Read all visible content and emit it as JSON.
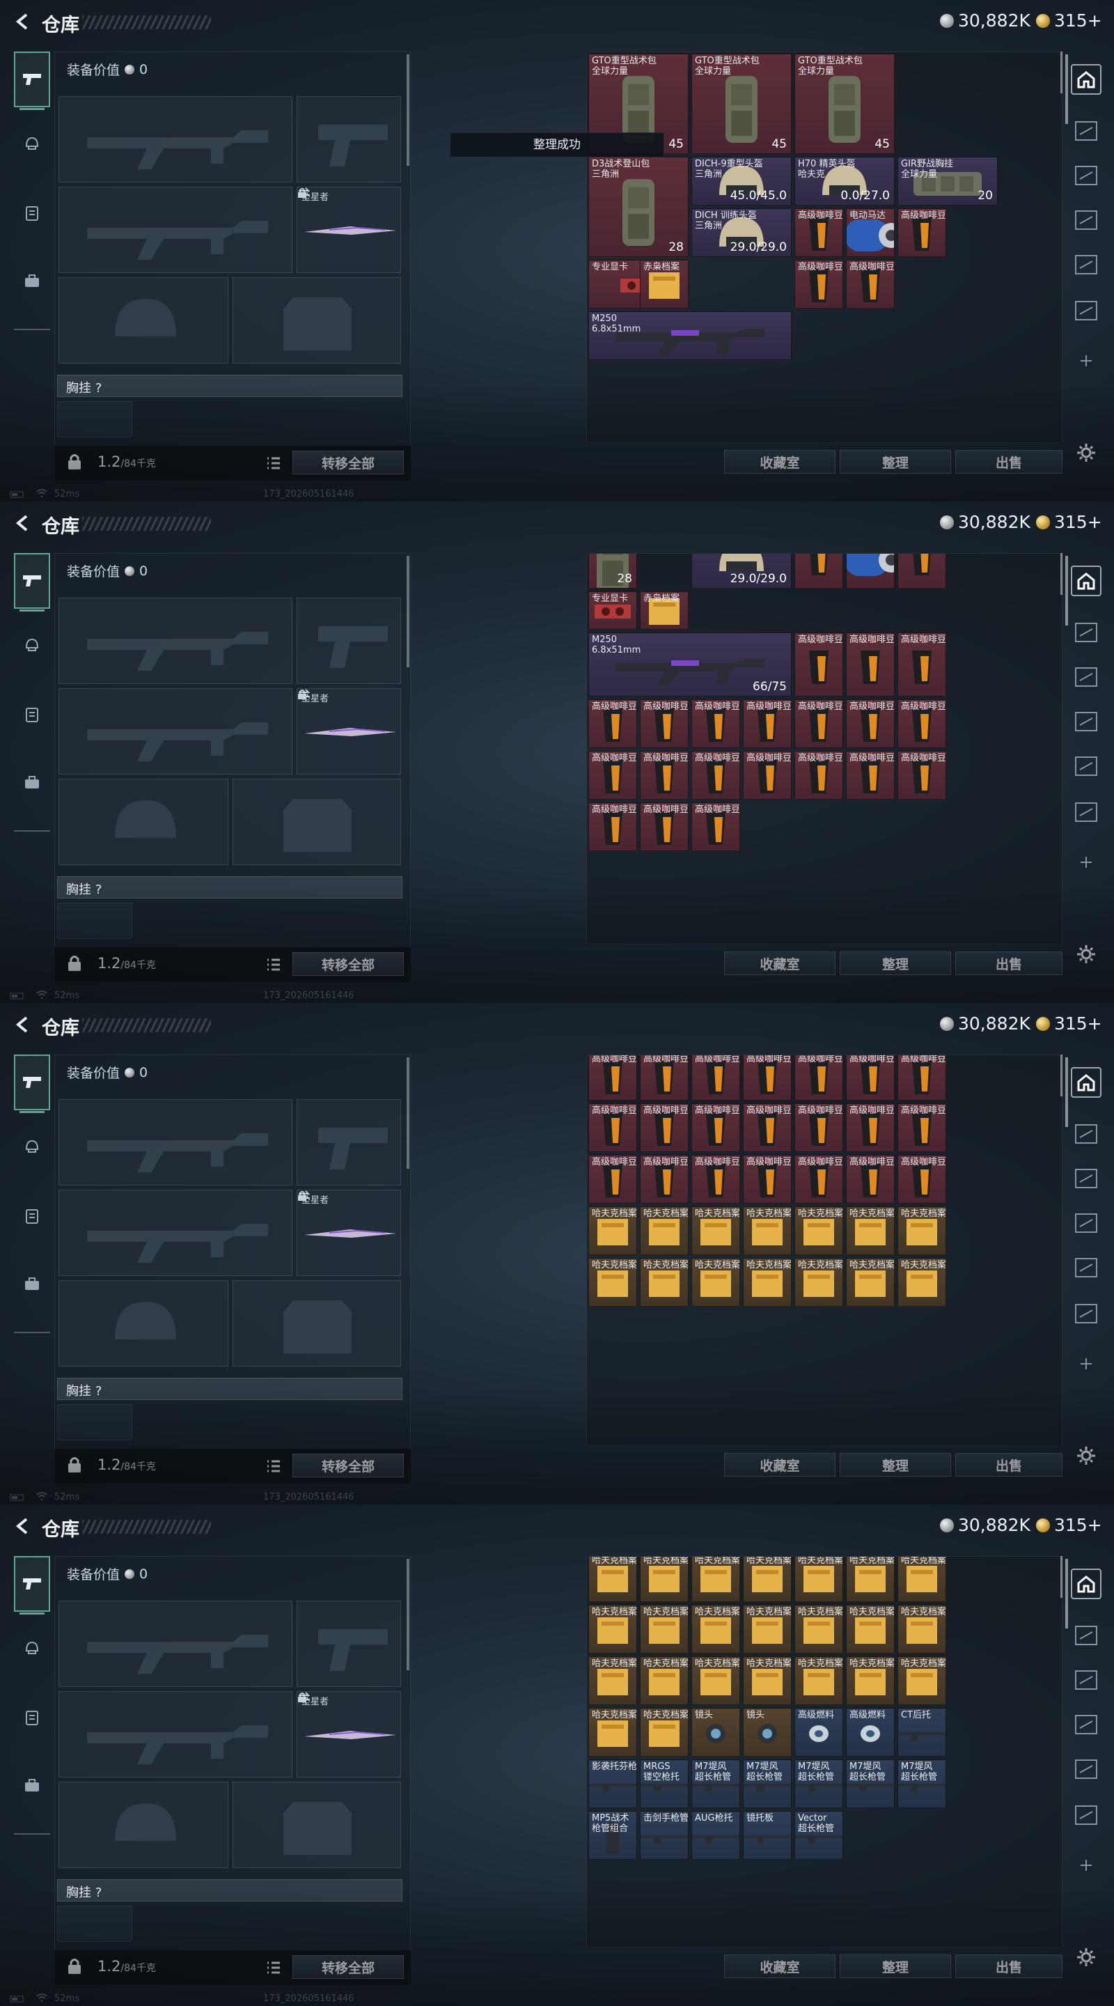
{
  "header": {
    "title": "仓库",
    "currency_silver": "30,882K",
    "currency_gold": "315+"
  },
  "loadout": {
    "equip_value_label": "装备价值",
    "equip_value": "0",
    "knife_label": "坠星者",
    "vest_label": "胸挂 ?",
    "weight_value": "1.2",
    "weight_capacity": "/84千克",
    "transfer_all": "转移全部"
  },
  "stash_buttons": {
    "collection": "收藏室",
    "sort": "整理",
    "sell": "出售"
  },
  "toast": "整理成功",
  "footer": {
    "ping": "52ms",
    "build": "173_202605161446"
  },
  "colors": {
    "rarity_red": "#5e2f38",
    "rarity_purple": "#3d3656",
    "rarity_gold": "#55432e",
    "rarity_blue": "#2e3e58",
    "accent": "#5fa890"
  },
  "icons": [
    "back-icon",
    "pistol-icon",
    "helmet-icon",
    "chestrig-icon",
    "briefcase-icon",
    "home-icon",
    "crosshair-icon",
    "plus-icon",
    "gear-icon",
    "lock-icon",
    "list-icon",
    "swap-icon"
  ],
  "screens": [
    {
      "show_toast": true,
      "stash_items": [
        {
          "name": "GTO重型战术包\n全球力量",
          "count": "45",
          "rarity": "red",
          "art": "backpack"
        },
        {
          "name": "GTO重型战术包\n全球力量",
          "count": "45",
          "rarity": "red",
          "art": "backpack"
        },
        {
          "name": "GTO重型战术包\n全球力量",
          "count": "45",
          "rarity": "red",
          "art": "backpack"
        },
        {
          "name": "D3战术登山包\n三角洲",
          "count": "28",
          "rarity": "red",
          "art": "backpack"
        },
        {
          "name": "DICH-9重型头盔\n三角洲",
          "count": "45.0/45.0",
          "rarity": "purple",
          "art": "helmet"
        },
        {
          "name": "H70 精英头盔\n哈夫克",
          "count": "0.0/27.0",
          "rarity": "purple",
          "art": "helmet"
        },
        {
          "name": "GIR野战胸挂\n全球力量",
          "count": "20",
          "rarity": "purple",
          "art": "rig"
        },
        {
          "name": "DICH 训练头盔\n三角洲",
          "count": "29.0/29.0",
          "rarity": "purple",
          "art": "helmet"
        },
        {
          "name": "专业显卡",
          "count": "",
          "rarity": "red",
          "art": "gpu"
        },
        {
          "name": "赤枭档案",
          "count": "",
          "rarity": "red",
          "art": "doc"
        },
        {
          "name": "高级咖啡豆",
          "count": "",
          "rarity": "red",
          "art": "coffee"
        },
        {
          "name": "电动马达",
          "count": "",
          "rarity": "red",
          "art": "motor"
        },
        {
          "name": "高级咖啡豆",
          "count": "",
          "rarity": "red",
          "art": "coffee"
        },
        {
          "name": "高级咖啡豆",
          "count": "",
          "rarity": "red",
          "art": "coffee"
        },
        {
          "name": "高级咖啡豆",
          "count": "",
          "rarity": "red",
          "art": "coffee"
        },
        {
          "name": "M250\n6.8x51mm",
          "count": "",
          "rarity": "purple",
          "art": "gun"
        }
      ]
    },
    {
      "show_toast": false,
      "stash_items": [
        {
          "name": "",
          "count": "28",
          "rarity": "red",
          "art": "backpack"
        },
        {
          "name": "DICH 训练头盔\n三角洲",
          "count": "29.0/29.0",
          "rarity": "purple",
          "art": "helmet"
        },
        {
          "name": "专业显卡",
          "count": "",
          "rarity": "red",
          "art": "gpu"
        },
        {
          "name": "赤枭档案",
          "count": "",
          "rarity": "red",
          "art": "doc"
        },
        {
          "name": "高级咖啡豆",
          "count": "",
          "rarity": "red",
          "art": "coffee"
        },
        {
          "name": "电动马达",
          "count": "",
          "rarity": "red",
          "art": "motor"
        },
        {
          "name": "高级咖啡豆",
          "count": "",
          "rarity": "red",
          "art": "coffee"
        },
        {
          "name": "M250\n6.8x51mm",
          "count": "66/75",
          "rarity": "purple",
          "art": "gun"
        },
        {
          "name": "高级咖啡豆",
          "count": "",
          "rarity": "red",
          "art": "coffee"
        },
        {
          "name": "高级咖啡豆",
          "count": "",
          "rarity": "red",
          "art": "coffee"
        },
        {
          "name": "高级咖啡豆",
          "count": "",
          "rarity": "red",
          "art": "coffee"
        },
        {
          "name": "高级咖啡豆",
          "count": "",
          "rarity": "red",
          "art": "coffee"
        },
        {
          "name": "高级咖啡豆",
          "count": "",
          "rarity": "red",
          "art": "coffee"
        },
        {
          "name": "高级咖啡豆",
          "count": "",
          "rarity": "red",
          "art": "coffee"
        },
        {
          "name": "高级咖啡豆",
          "count": "",
          "rarity": "red",
          "art": "coffee"
        },
        {
          "name": "高级咖啡豆",
          "count": "",
          "rarity": "red",
          "art": "coffee"
        },
        {
          "name": "高级咖啡豆",
          "count": "",
          "rarity": "red",
          "art": "coffee"
        },
        {
          "name": "高级咖啡豆",
          "count": "",
          "rarity": "red",
          "art": "coffee"
        },
        {
          "name": "高级咖啡豆",
          "count": "",
          "rarity": "red",
          "art": "coffee"
        },
        {
          "name": "高级咖啡豆",
          "count": "",
          "rarity": "red",
          "art": "coffee"
        },
        {
          "name": "高级咖啡豆",
          "count": "",
          "rarity": "red",
          "art": "coffee"
        },
        {
          "name": "高级咖啡豆",
          "count": "",
          "rarity": "red",
          "art": "coffee"
        },
        {
          "name": "高级咖啡豆",
          "count": "",
          "rarity": "red",
          "art": "coffee"
        },
        {
          "name": "高级咖啡豆",
          "count": "",
          "rarity": "red",
          "art": "coffee"
        },
        {
          "name": "高级咖啡豆",
          "count": "",
          "rarity": "red",
          "art": "coffee"
        },
        {
          "name": "高级咖啡豆",
          "count": "",
          "rarity": "red",
          "art": "coffee"
        },
        {
          "name": "高级咖啡豆",
          "count": "",
          "rarity": "red",
          "art": "coffee"
        },
        {
          "name": "高级咖啡豆",
          "count": "",
          "rarity": "red",
          "art": "coffee"
        }
      ]
    },
    {
      "show_toast": false,
      "stash_items": [
        {
          "name": "高级咖啡豆",
          "count": "",
          "rarity": "red",
          "art": "coffee"
        },
        {
          "name": "高级咖啡豆",
          "count": "",
          "rarity": "red",
          "art": "coffee"
        },
        {
          "name": "高级咖啡豆",
          "count": "",
          "rarity": "red",
          "art": "coffee"
        },
        {
          "name": "高级咖啡豆",
          "count": "",
          "rarity": "red",
          "art": "coffee"
        },
        {
          "name": "高级咖啡豆",
          "count": "",
          "rarity": "red",
          "art": "coffee"
        },
        {
          "name": "高级咖啡豆",
          "count": "",
          "rarity": "red",
          "art": "coffee"
        },
        {
          "name": "高级咖啡豆",
          "count": "",
          "rarity": "red",
          "art": "coffee"
        },
        {
          "name": "高级咖啡豆",
          "count": "",
          "rarity": "red",
          "art": "coffee"
        },
        {
          "name": "高级咖啡豆",
          "count": "",
          "rarity": "red",
          "art": "coffee"
        },
        {
          "name": "高级咖啡豆",
          "count": "",
          "rarity": "red",
          "art": "coffee"
        },
        {
          "name": "高级咖啡豆",
          "count": "",
          "rarity": "red",
          "art": "coffee"
        },
        {
          "name": "高级咖啡豆",
          "count": "",
          "rarity": "red",
          "art": "coffee"
        },
        {
          "name": "高级咖啡豆",
          "count": "",
          "rarity": "red",
          "art": "coffee"
        },
        {
          "name": "高级咖啡豆",
          "count": "",
          "rarity": "red",
          "art": "coffee"
        },
        {
          "name": "高级咖啡豆",
          "count": "",
          "rarity": "red",
          "art": "coffee"
        },
        {
          "name": "高级咖啡豆",
          "count": "",
          "rarity": "red",
          "art": "coffee"
        },
        {
          "name": "高级咖啡豆",
          "count": "",
          "rarity": "red",
          "art": "coffee"
        },
        {
          "name": "高级咖啡豆",
          "count": "",
          "rarity": "red",
          "art": "coffee"
        },
        {
          "name": "高级咖啡豆",
          "count": "",
          "rarity": "red",
          "art": "coffee"
        },
        {
          "name": "高级咖啡豆",
          "count": "",
          "rarity": "red",
          "art": "coffee"
        },
        {
          "name": "高级咖啡豆",
          "count": "",
          "rarity": "red",
          "art": "coffee"
        },
        {
          "name": "哈夫克档案",
          "count": "",
          "rarity": "gold",
          "art": "doc"
        },
        {
          "name": "哈夫克档案",
          "count": "",
          "rarity": "gold",
          "art": "doc"
        },
        {
          "name": "哈夫克档案",
          "count": "",
          "rarity": "gold",
          "art": "doc"
        },
        {
          "name": "哈夫克档案",
          "count": "",
          "rarity": "gold",
          "art": "doc"
        },
        {
          "name": "哈夫克档案",
          "count": "",
          "rarity": "gold",
          "art": "doc"
        },
        {
          "name": "哈夫克档案",
          "count": "",
          "rarity": "gold",
          "art": "doc"
        },
        {
          "name": "哈夫克档案",
          "count": "",
          "rarity": "gold",
          "art": "doc"
        },
        {
          "name": "哈夫克档案",
          "count": "",
          "rarity": "gold",
          "art": "doc"
        },
        {
          "name": "哈夫克档案",
          "count": "",
          "rarity": "gold",
          "art": "doc"
        },
        {
          "name": "哈夫克档案",
          "count": "",
          "rarity": "gold",
          "art": "doc"
        },
        {
          "name": "哈夫克档案",
          "count": "",
          "rarity": "gold",
          "art": "doc"
        },
        {
          "name": "哈夫克档案",
          "count": "",
          "rarity": "gold",
          "art": "doc"
        },
        {
          "name": "哈夫克档案",
          "count": "",
          "rarity": "gold",
          "art": "doc"
        },
        {
          "name": "哈夫克档案",
          "count": "",
          "rarity": "gold",
          "art": "doc"
        }
      ]
    },
    {
      "show_toast": false,
      "stash_items": [
        {
          "name": "哈夫克档案",
          "count": "",
          "rarity": "gold",
          "art": "doc"
        },
        {
          "name": "哈夫克档案",
          "count": "",
          "rarity": "gold",
          "art": "doc"
        },
        {
          "name": "哈夫克档案",
          "count": "",
          "rarity": "gold",
          "art": "doc"
        },
        {
          "name": "哈夫克档案",
          "count": "",
          "rarity": "gold",
          "art": "doc"
        },
        {
          "name": "哈夫克档案",
          "count": "",
          "rarity": "gold",
          "art": "doc"
        },
        {
          "name": "哈夫克档案",
          "count": "",
          "rarity": "gold",
          "art": "doc"
        },
        {
          "name": "哈夫克档案",
          "count": "",
          "rarity": "gold",
          "art": "doc"
        },
        {
          "name": "哈夫克档案",
          "count": "",
          "rarity": "gold",
          "art": "doc"
        },
        {
          "name": "哈夫克档案",
          "count": "",
          "rarity": "gold",
          "art": "doc"
        },
        {
          "name": "哈夫克档案",
          "count": "",
          "rarity": "gold",
          "art": "doc"
        },
        {
          "name": "哈夫克档案",
          "count": "",
          "rarity": "gold",
          "art": "doc"
        },
        {
          "name": "哈夫克档案",
          "count": "",
          "rarity": "gold",
          "art": "doc"
        },
        {
          "name": "哈夫克档案",
          "count": "",
          "rarity": "gold",
          "art": "doc"
        },
        {
          "name": "哈夫克档案",
          "count": "",
          "rarity": "gold",
          "art": "doc"
        },
        {
          "name": "哈夫克档案",
          "count": "",
          "rarity": "gold",
          "art": "doc"
        },
        {
          "name": "哈夫克档案",
          "count": "",
          "rarity": "gold",
          "art": "doc"
        },
        {
          "name": "哈夫克档案",
          "count": "",
          "rarity": "gold",
          "art": "doc"
        },
        {
          "name": "哈夫克档案",
          "count": "",
          "rarity": "gold",
          "art": "doc"
        },
        {
          "name": "哈夫克档案",
          "count": "",
          "rarity": "gold",
          "art": "doc"
        },
        {
          "name": "哈夫克档案",
          "count": "",
          "rarity": "gold",
          "art": "doc"
        },
        {
          "name": "哈夫克档案",
          "count": "",
          "rarity": "gold",
          "art": "doc"
        },
        {
          "name": "哈夫克档案",
          "count": "",
          "rarity": "gold",
          "art": "doc"
        },
        {
          "name": "哈夫克档案",
          "count": "",
          "rarity": "gold",
          "art": "doc"
        },
        {
          "name": "镜头",
          "count": "",
          "rarity": "gold",
          "art": "lens"
        },
        {
          "name": "镜头",
          "count": "",
          "rarity": "gold",
          "art": "lens"
        },
        {
          "name": "高级燃料",
          "count": "",
          "rarity": "blue",
          "art": "can"
        },
        {
          "name": "高级燃料",
          "count": "",
          "rarity": "blue",
          "art": "can"
        },
        {
          "name": "CT后托",
          "count": "",
          "rarity": "blue",
          "art": "part"
        },
        {
          "name": "影袭托芬枪托",
          "count": "",
          "rarity": "blue",
          "art": "part"
        },
        {
          "name": "MRGS\n镂空枪托",
          "count": "",
          "rarity": "blue",
          "art": "part"
        },
        {
          "name": "M7堤风\n超长枪管",
          "count": "",
          "rarity": "blue",
          "art": "part"
        },
        {
          "name": "M7堤风\n超长枪管",
          "count": "",
          "rarity": "blue",
          "art": "part"
        },
        {
          "name": "M7堤风\n超长枪管",
          "count": "",
          "rarity": "blue",
          "art": "part"
        },
        {
          "name": "M7堤风\n超长枪管",
          "count": "",
          "rarity": "blue",
          "art": "part"
        },
        {
          "name": "M7堤风\n超长枪管",
          "count": "",
          "rarity": "blue",
          "art": "part"
        },
        {
          "name": "MP5战术\n枪管组合",
          "count": "",
          "rarity": "blue",
          "art": "radio"
        },
        {
          "name": "击剑手枪管",
          "count": "",
          "rarity": "blue",
          "art": "part"
        },
        {
          "name": "AUG枪托",
          "count": "",
          "rarity": "blue",
          "art": "part"
        },
        {
          "name": "镜托板",
          "count": "",
          "rarity": "blue",
          "art": "part"
        },
        {
          "name": "Vector\n超长枪管",
          "count": "",
          "rarity": "blue",
          "art": "part"
        }
      ]
    }
  ]
}
